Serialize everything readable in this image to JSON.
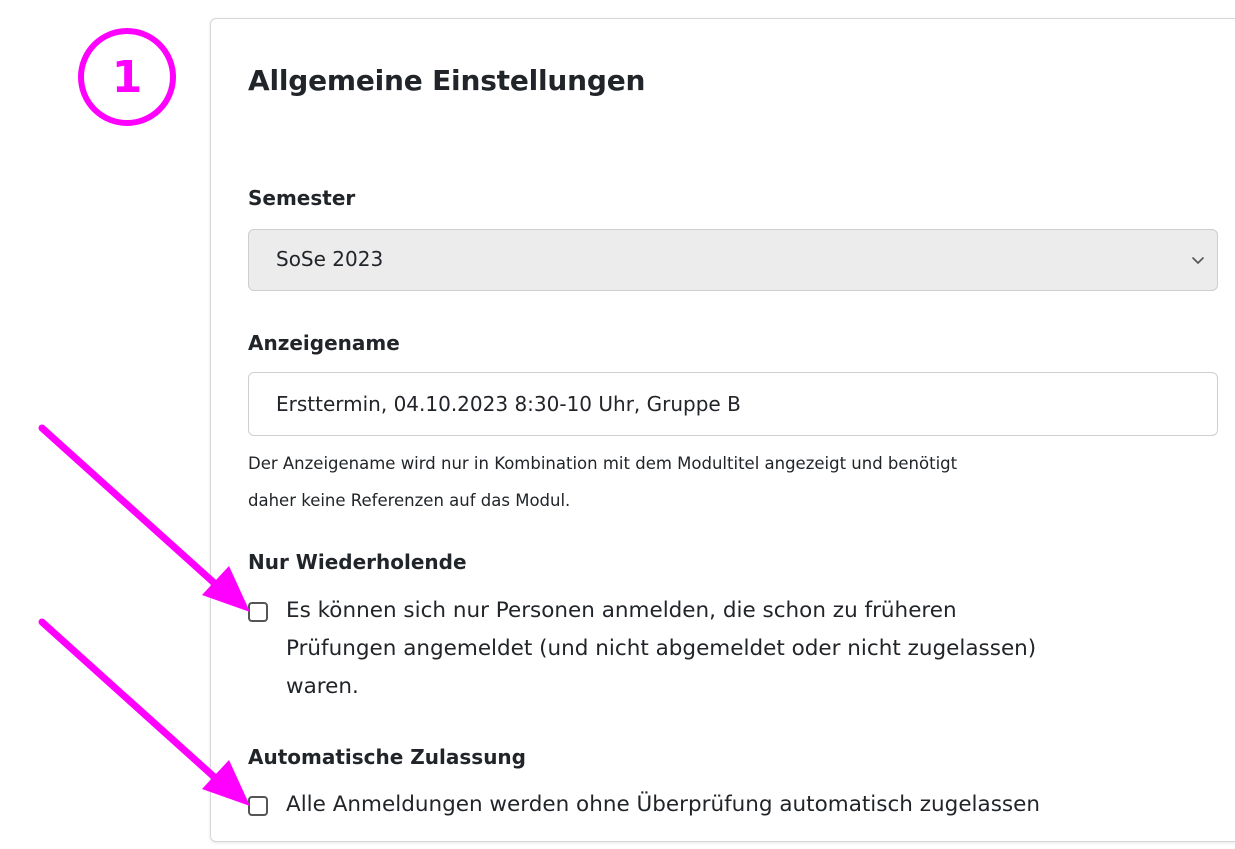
{
  "annotation": {
    "step_number": "1",
    "color": "#ff00ff"
  },
  "settings": {
    "title": "Allgemeine Einstellungen",
    "semester": {
      "label": "Semester",
      "selected": "SoSe 2023",
      "icon": "chevron-down-icon"
    },
    "display_name": {
      "label": "Anzeigename",
      "value": "Ersttermin, 04.10.2023 8:30-10 Uhr, Gruppe B",
      "help_line_1": "Der Anzeigename wird nur in Kombination mit dem Modultitel angezeigt und benötigt",
      "help_line_2": "daher keine Referenzen auf das Modul."
    },
    "repeaters_only": {
      "label": "Nur Wiederholende",
      "checked": false,
      "text_line_1": "Es können sich nur Personen anmelden, die schon zu früheren",
      "text_line_2": "Prüfungen angemeldet (und nicht abgemeldet oder nicht zugelassen)",
      "text_line_3": "waren."
    },
    "auto_admission": {
      "label": "Automatische Zulassung",
      "checked": false,
      "text": "Alle Anmeldungen werden ohne Überprüfung automatisch zugelassen"
    }
  }
}
